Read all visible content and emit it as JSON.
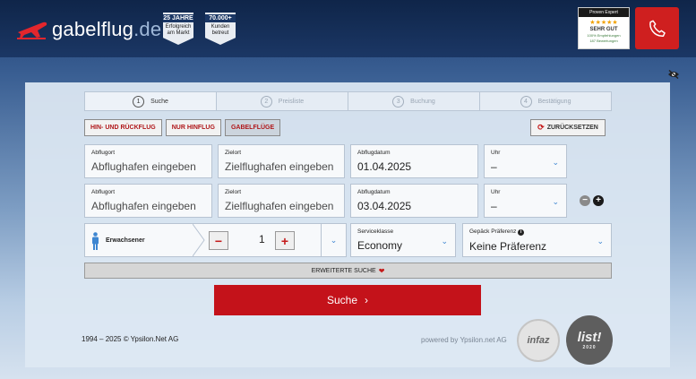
{
  "header": {
    "logo_name": "gabelflug",
    "logo_tld": ".de",
    "badge1_top": "25 JAHRE",
    "badge1_bottom": "Erfolgreich am Markt",
    "badge2_top": "70.000+",
    "badge2_bottom": "Kunden betreut",
    "expert_head": "Proven Expert",
    "expert_stars": "★★★★★",
    "expert_grade": "SEHR GUT",
    "expert_small": "100% Empfehlungen",
    "expert_small2": "187 Bewertungen",
    "accent": "#cf1f1f"
  },
  "steps": [
    {
      "num": "1",
      "label": "Suche"
    },
    {
      "num": "2",
      "label": "Preisliste"
    },
    {
      "num": "3",
      "label": "Buchung"
    },
    {
      "num": "4",
      "label": "Bestätigung"
    }
  ],
  "tabs": {
    "roundtrip": "HIN- UND RÜCKFLUG",
    "oneway": "NUR HINFLUG",
    "openjaw": "GABELFLÜGE",
    "reset": "ZURÜCKSETZEN"
  },
  "legs": [
    {
      "origin_label": "Abflugort",
      "origin_value": "Abflughafen eingeben",
      "dest_label": "Zielort",
      "dest_value": "Zielflughafen eingeben",
      "date_label": "Abflugdatum",
      "date_value": "01.04.2025",
      "time_label": "Uhr",
      "time_value": "–"
    },
    {
      "origin_label": "Abflugort",
      "origin_value": "Abflughafen eingeben",
      "dest_label": "Zielort",
      "dest_value": "Zielflughafen eingeben",
      "date_label": "Abflugdatum",
      "date_value": "03.04.2025",
      "time_label": "Uhr",
      "time_value": "–"
    }
  ],
  "passengers": {
    "label": "Erwachsener",
    "count": "1",
    "minus": "−",
    "plus": "+"
  },
  "service": {
    "label": "Serviceklasse",
    "value": "Economy"
  },
  "baggage": {
    "label": "Gepäck Präferenz",
    "value": "Keine Präferenz",
    "info": "i"
  },
  "advanced": "ERWEITERTE SUCHE",
  "search_button": "Suche",
  "footer": {
    "copyright": "1994 – 2025 © Ypsilon.Net AG",
    "powered": "powered by Ypsilon.net AG",
    "seal1": "infaz",
    "seal2": "list!",
    "seal2_year": "2020"
  },
  "icons": {
    "logo": "plane-icon",
    "phone": "phone-icon",
    "hide": "eye-off-icon",
    "reset": "refresh-icon",
    "dropdown": "chevron-down-icon",
    "person": "person-icon",
    "search": "chevron-right-icon"
  }
}
